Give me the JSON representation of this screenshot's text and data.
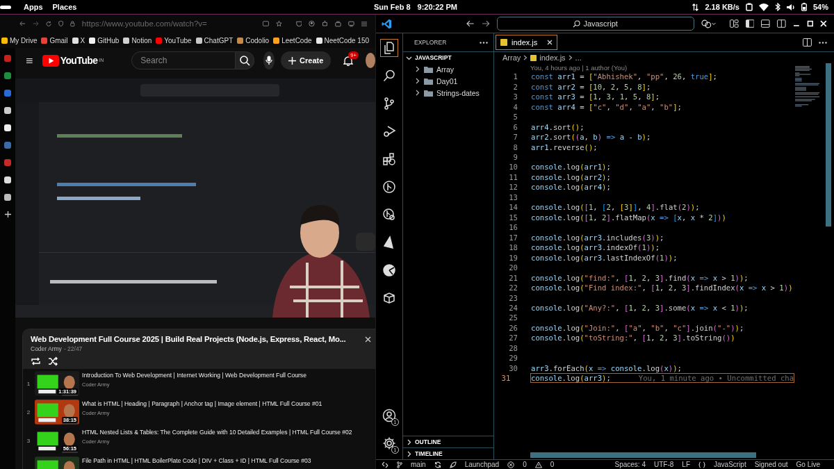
{
  "system_bar": {
    "menus": [
      "Apps",
      "Places"
    ],
    "date": "Sun Feb 8",
    "time": "9:20:22 PM",
    "network_speed": "2.18 KB/s",
    "battery": "54%"
  },
  "browser": {
    "url": "https://www.youtube.com/watch?v=",
    "bookmarks": [
      {
        "label": "My Drive",
        "color": "#fbbc04"
      },
      {
        "label": "Gmail",
        "color": "#ea4335"
      },
      {
        "label": "X",
        "color": "#e0e0e0"
      },
      {
        "label": "GitHub",
        "color": "#f0f0f0"
      },
      {
        "label": "Notion",
        "color": "#d0d0d0"
      },
      {
        "label": "YouTube",
        "color": "#ff0000"
      },
      {
        "label": "ChatGPT",
        "color": "#c8c8c8"
      },
      {
        "label": "Codolio",
        "color": "#c58a4a"
      },
      {
        "label": "LeetCode",
        "color": "#ffa116"
      },
      {
        "label": "NeetCode 150",
        "color": "#e8e8e8"
      }
    ]
  },
  "youtube": {
    "logo": "YouTube",
    "country": "IN",
    "search": {
      "placeholder": "Search"
    },
    "create": "Create",
    "notifications": "9+",
    "playlist": {
      "title": "Web Development Full Course 2025 | Build Real Projects (Node.js, Express, React, Mo...",
      "channel": "Coder Army",
      "position": "- 22/47",
      "items": [
        {
          "index": "1",
          "duration": "1:31:39",
          "title": "Introduction To Web Development | Internet Working | Web Development Full Course",
          "channel": "Coder Army"
        },
        {
          "index": "2",
          "duration": "38:15",
          "title": "What is HTML | Heading | Paragraph | Anchor tag | Image element | HTML Full Course #01",
          "channel": "Coder Army"
        },
        {
          "index": "3",
          "duration": "56:15",
          "title": "HTML Nested Lists & Tables: The Complete Guide with 10 Detailed Examples | HTML Full Course #02",
          "channel": "Coder Army"
        },
        {
          "title": "File Path in HTML | HTML BoilerPlate Code | DIV + Class + ID | HTML Full Course #03"
        }
      ]
    }
  },
  "vscode": {
    "command_center": "Javascript",
    "activity_bar": [
      {
        "kind": "files",
        "selected": true
      },
      {
        "kind": "search",
        "selected": false
      },
      {
        "kind": "branch",
        "selected": false
      },
      {
        "kind": "run",
        "selected": false
      },
      {
        "kind": "extensions",
        "selected": false
      },
      {
        "kind": "graph",
        "selected": false
      },
      {
        "kind": "inspect",
        "selected": false
      },
      {
        "kind": "triangle",
        "selected": false
      },
      {
        "kind": "pie",
        "selected": false
      },
      {
        "kind": "cube",
        "selected": false
      }
    ],
    "activity_bottom": [
      {
        "kind": "account",
        "badge": "1"
      },
      {
        "kind": "settings",
        "badge": "1"
      }
    ],
    "explorer": {
      "title": "EXPLORER",
      "sections": [
        {
          "title": "JAVASCRIPT",
          "expanded": true,
          "children": [
            {
              "label": "Array",
              "expanded": false
            },
            {
              "label": "Day01",
              "expanded": false
            },
            {
              "label": "Strings-dates",
              "expanded": false
            }
          ]
        },
        {
          "title": "OUTLINE",
          "expanded": false
        },
        {
          "title": "TIMELINE",
          "expanded": false
        }
      ]
    },
    "tabs": [
      {
        "label": "index.js",
        "selected": true
      }
    ],
    "breadcrumb": [
      "Array",
      "index.js",
      "..."
    ],
    "blame": "You, 4 hours ago | 1 author (You)",
    "lines": [
      {
        "number": "1",
        "active": false,
        "tokens": [
          {
            "kind": "kw",
            "text": "const "
          },
          {
            "kind": "id",
            "text": "arr1"
          },
          {
            "kind": "op",
            "text": " = "
          },
          {
            "kind": "br1",
            "text": "["
          },
          {
            "kind": "str",
            "text": "\"Abhishek\""
          },
          {
            "kind": "op",
            "text": ", "
          },
          {
            "kind": "str",
            "text": "\"pp\""
          },
          {
            "kind": "op",
            "text": ", "
          },
          {
            "kind": "num",
            "text": "26"
          },
          {
            "kind": "op",
            "text": ", "
          },
          {
            "kind": "kw",
            "text": "true"
          },
          {
            "kind": "br1",
            "text": "]"
          },
          {
            "kind": "op",
            "text": ";"
          }
        ]
      },
      {
        "number": "2",
        "active": false,
        "tokens": [
          {
            "kind": "kw",
            "text": "const "
          },
          {
            "kind": "id",
            "text": "arr2"
          },
          {
            "kind": "op",
            "text": " = "
          },
          {
            "kind": "br1",
            "text": "["
          },
          {
            "kind": "num",
            "text": "10"
          },
          {
            "kind": "op",
            "text": ", "
          },
          {
            "kind": "num",
            "text": "2"
          },
          {
            "kind": "op",
            "text": ", "
          },
          {
            "kind": "num",
            "text": "5"
          },
          {
            "kind": "op",
            "text": ", "
          },
          {
            "kind": "num",
            "text": "8"
          },
          {
            "kind": "br1",
            "text": "]"
          },
          {
            "kind": "op",
            "text": ";"
          }
        ]
      },
      {
        "number": "3",
        "active": false,
        "tokens": [
          {
            "kind": "kw",
            "text": "const "
          },
          {
            "kind": "id",
            "text": "arr3"
          },
          {
            "kind": "op",
            "text": " = "
          },
          {
            "kind": "br1",
            "text": "["
          },
          {
            "kind": "num",
            "text": "1"
          },
          {
            "kind": "op",
            "text": ", "
          },
          {
            "kind": "num",
            "text": "3"
          },
          {
            "kind": "op",
            "text": ", "
          },
          {
            "kind": "num",
            "text": "1"
          },
          {
            "kind": "op",
            "text": ", "
          },
          {
            "kind": "num",
            "text": "5"
          },
          {
            "kind": "op",
            "text": ", "
          },
          {
            "kind": "num",
            "text": "8"
          },
          {
            "kind": "br1",
            "text": "]"
          },
          {
            "kind": "op",
            "text": ";"
          }
        ]
      },
      {
        "number": "4",
        "active": false,
        "tokens": [
          {
            "kind": "kw",
            "text": "const "
          },
          {
            "kind": "id",
            "text": "arr4"
          },
          {
            "kind": "op",
            "text": " = "
          },
          {
            "kind": "br1",
            "text": "["
          },
          {
            "kind": "str",
            "text": "\"c\""
          },
          {
            "kind": "op",
            "text": ", "
          },
          {
            "kind": "str",
            "text": "\"d\""
          },
          {
            "kind": "op",
            "text": ", "
          },
          {
            "kind": "str",
            "text": "\"a\""
          },
          {
            "kind": "op",
            "text": ", "
          },
          {
            "kind": "str",
            "text": "\"b\""
          },
          {
            "kind": "br1",
            "text": "]"
          },
          {
            "kind": "op",
            "text": ";"
          }
        ]
      },
      {
        "number": "5",
        "active": false
      },
      {
        "number": "6",
        "active": false,
        "tokens": [
          {
            "kind": "id",
            "text": "arr4"
          },
          {
            "kind": "op",
            "text": ".sort"
          },
          {
            "kind": "br1",
            "text": "()"
          },
          {
            "kind": "op",
            "text": ";"
          }
        ]
      },
      {
        "number": "7",
        "active": false,
        "tokens": [
          {
            "kind": "id",
            "text": "arr2"
          },
          {
            "kind": "op",
            "text": ".sort"
          },
          {
            "kind": "br1",
            "text": "("
          },
          {
            "kind": "br2",
            "text": "("
          },
          {
            "kind": "id",
            "text": "a"
          },
          {
            "kind": "op",
            "text": ", "
          },
          {
            "kind": "id",
            "text": "b"
          },
          {
            "kind": "br2",
            "text": ")"
          },
          {
            "kind": "kw",
            "text": " => "
          },
          {
            "kind": "id",
            "text": "a"
          },
          {
            "kind": "op",
            "text": " - "
          },
          {
            "kind": "id",
            "text": "b"
          },
          {
            "kind": "br1",
            "text": ")"
          },
          {
            "kind": "op",
            "text": ";"
          }
        ]
      },
      {
        "number": "8",
        "active": false,
        "tokens": [
          {
            "kind": "id",
            "text": "arr1"
          },
          {
            "kind": "op",
            "text": ".reverse"
          },
          {
            "kind": "br1",
            "text": "()"
          },
          {
            "kind": "op",
            "text": ";"
          }
        ]
      },
      {
        "number": "9",
        "active": false
      },
      {
        "number": "10",
        "active": false,
        "tokens": [
          {
            "kind": "id",
            "text": "console"
          },
          {
            "kind": "op",
            "text": ".log"
          },
          {
            "kind": "br1",
            "text": "("
          },
          {
            "kind": "id",
            "text": "arr1"
          },
          {
            "kind": "br1",
            "text": ")"
          },
          {
            "kind": "op",
            "text": ";"
          }
        ]
      },
      {
        "number": "11",
        "active": false,
        "tokens": [
          {
            "kind": "id",
            "text": "console"
          },
          {
            "kind": "op",
            "text": ".log"
          },
          {
            "kind": "br1",
            "text": "("
          },
          {
            "kind": "id",
            "text": "arr2"
          },
          {
            "kind": "br1",
            "text": ")"
          },
          {
            "kind": "op",
            "text": ";"
          }
        ]
      },
      {
        "number": "12",
        "active": false,
        "tokens": [
          {
            "kind": "id",
            "text": "console"
          },
          {
            "kind": "op",
            "text": ".log"
          },
          {
            "kind": "br1",
            "text": "("
          },
          {
            "kind": "id",
            "text": "arr4"
          },
          {
            "kind": "br1",
            "text": ")"
          },
          {
            "kind": "op",
            "text": ";"
          }
        ]
      },
      {
        "number": "13",
        "active": false
      },
      {
        "number": "14",
        "active": false,
        "tokens": [
          {
            "kind": "id",
            "text": "console"
          },
          {
            "kind": "op",
            "text": ".log"
          },
          {
            "kind": "br1",
            "text": "("
          },
          {
            "kind": "br2",
            "text": "["
          },
          {
            "kind": "num",
            "text": "1"
          },
          {
            "kind": "op",
            "text": ", "
          },
          {
            "kind": "br3",
            "text": "["
          },
          {
            "kind": "num",
            "text": "2"
          },
          {
            "kind": "op",
            "text": ", "
          },
          {
            "kind": "br1",
            "text": "["
          },
          {
            "kind": "num",
            "text": "3"
          },
          {
            "kind": "br1",
            "text": "]"
          },
          {
            "kind": "br3",
            "text": "]"
          },
          {
            "kind": "op",
            "text": ", "
          },
          {
            "kind": "num",
            "text": "4"
          },
          {
            "kind": "br2",
            "text": "]"
          },
          {
            "kind": "op",
            "text": ".flat"
          },
          {
            "kind": "br2",
            "text": "("
          },
          {
            "kind": "num",
            "text": "2"
          },
          {
            "kind": "br2",
            "text": ")"
          },
          {
            "kind": "br1",
            "text": ")"
          },
          {
            "kind": "op",
            "text": ";"
          }
        ]
      },
      {
        "number": "15",
        "active": false,
        "tokens": [
          {
            "kind": "id",
            "text": "console"
          },
          {
            "kind": "op",
            "text": ".log"
          },
          {
            "kind": "br1",
            "text": "("
          },
          {
            "kind": "br2",
            "text": "["
          },
          {
            "kind": "num",
            "text": "1"
          },
          {
            "kind": "op",
            "text": ", "
          },
          {
            "kind": "num",
            "text": "2"
          },
          {
            "kind": "br2",
            "text": "]"
          },
          {
            "kind": "op",
            "text": ".flatMap"
          },
          {
            "kind": "br2",
            "text": "("
          },
          {
            "kind": "id",
            "text": "x"
          },
          {
            "kind": "kw",
            "text": " => "
          },
          {
            "kind": "br3",
            "text": "["
          },
          {
            "kind": "id",
            "text": "x"
          },
          {
            "kind": "op",
            "text": ", "
          },
          {
            "kind": "id",
            "text": "x"
          },
          {
            "kind": "op",
            "text": " * "
          },
          {
            "kind": "num",
            "text": "2"
          },
          {
            "kind": "br3",
            "text": "]"
          },
          {
            "kind": "br2",
            "text": ")"
          },
          {
            "kind": "br1",
            "text": ")"
          }
        ]
      },
      {
        "number": "16",
        "active": false
      },
      {
        "number": "17",
        "active": false,
        "tokens": [
          {
            "kind": "id",
            "text": "console"
          },
          {
            "kind": "op",
            "text": ".log"
          },
          {
            "kind": "br1",
            "text": "("
          },
          {
            "kind": "id",
            "text": "arr3"
          },
          {
            "kind": "op",
            "text": ".includes"
          },
          {
            "kind": "br2",
            "text": "("
          },
          {
            "kind": "num",
            "text": "3"
          },
          {
            "kind": "br2",
            "text": ")"
          },
          {
            "kind": "br1",
            "text": ")"
          },
          {
            "kind": "op",
            "text": ";"
          }
        ]
      },
      {
        "number": "18",
        "active": false,
        "tokens": [
          {
            "kind": "id",
            "text": "console"
          },
          {
            "kind": "op",
            "text": ".log"
          },
          {
            "kind": "br1",
            "text": "("
          },
          {
            "kind": "id",
            "text": "arr3"
          },
          {
            "kind": "op",
            "text": ".indexOf"
          },
          {
            "kind": "br2",
            "text": "("
          },
          {
            "kind": "num",
            "text": "1"
          },
          {
            "kind": "br2",
            "text": ")"
          },
          {
            "kind": "br1",
            "text": ")"
          },
          {
            "kind": "op",
            "text": ";"
          }
        ]
      },
      {
        "number": "19",
        "active": false,
        "tokens": [
          {
            "kind": "id",
            "text": "console"
          },
          {
            "kind": "op",
            "text": ".log"
          },
          {
            "kind": "br1",
            "text": "("
          },
          {
            "kind": "id",
            "text": "arr3"
          },
          {
            "kind": "op",
            "text": ".lastIndexOf"
          },
          {
            "kind": "br2",
            "text": "("
          },
          {
            "kind": "num",
            "text": "1"
          },
          {
            "kind": "br2",
            "text": ")"
          },
          {
            "kind": "br1",
            "text": ")"
          },
          {
            "kind": "op",
            "text": ";"
          }
        ]
      },
      {
        "number": "20",
        "active": false
      },
      {
        "number": "21",
        "active": false,
        "tokens": [
          {
            "kind": "id",
            "text": "console"
          },
          {
            "kind": "op",
            "text": ".log"
          },
          {
            "kind": "br1",
            "text": "("
          },
          {
            "kind": "str",
            "text": "\"find:\""
          },
          {
            "kind": "op",
            "text": ", "
          },
          {
            "kind": "br2",
            "text": "["
          },
          {
            "kind": "num",
            "text": "1"
          },
          {
            "kind": "op",
            "text": ", "
          },
          {
            "kind": "num",
            "text": "2"
          },
          {
            "kind": "op",
            "text": ", "
          },
          {
            "kind": "num",
            "text": "3"
          },
          {
            "kind": "br2",
            "text": "]"
          },
          {
            "kind": "op",
            "text": ".find"
          },
          {
            "kind": "br2",
            "text": "("
          },
          {
            "kind": "id",
            "text": "x"
          },
          {
            "kind": "kw",
            "text": " => "
          },
          {
            "kind": "id",
            "text": "x"
          },
          {
            "kind": "op",
            "text": " > "
          },
          {
            "kind": "num",
            "text": "1"
          },
          {
            "kind": "br2",
            "text": ")"
          },
          {
            "kind": "br1",
            "text": ")"
          },
          {
            "kind": "op",
            "text": ";"
          }
        ]
      },
      {
        "number": "22",
        "active": false,
        "tokens": [
          {
            "kind": "id",
            "text": "console"
          },
          {
            "kind": "op",
            "text": ".log"
          },
          {
            "kind": "br1",
            "text": "("
          },
          {
            "kind": "str",
            "text": "\"Find index:\""
          },
          {
            "kind": "op",
            "text": ", "
          },
          {
            "kind": "br2",
            "text": "["
          },
          {
            "kind": "num",
            "text": "1"
          },
          {
            "kind": "op",
            "text": ", "
          },
          {
            "kind": "num",
            "text": "2"
          },
          {
            "kind": "op",
            "text": ", "
          },
          {
            "kind": "num",
            "text": "3"
          },
          {
            "kind": "br2",
            "text": "]"
          },
          {
            "kind": "op",
            "text": ".findIndex"
          },
          {
            "kind": "br2",
            "text": "("
          },
          {
            "kind": "id",
            "text": "x"
          },
          {
            "kind": "kw",
            "text": " => "
          },
          {
            "kind": "id",
            "text": "x"
          },
          {
            "kind": "op",
            "text": " > "
          },
          {
            "kind": "num",
            "text": "1"
          },
          {
            "kind": "br2",
            "text": ")"
          },
          {
            "kind": "br1",
            "text": ")"
          }
        ]
      },
      {
        "number": "23",
        "active": false
      },
      {
        "number": "24",
        "active": false,
        "tokens": [
          {
            "kind": "id",
            "text": "console"
          },
          {
            "kind": "op",
            "text": ".log"
          },
          {
            "kind": "br1",
            "text": "("
          },
          {
            "kind": "str",
            "text": "\"Any?:\""
          },
          {
            "kind": "op",
            "text": ", "
          },
          {
            "kind": "br2",
            "text": "["
          },
          {
            "kind": "num",
            "text": "1"
          },
          {
            "kind": "op",
            "text": ", "
          },
          {
            "kind": "num",
            "text": "2"
          },
          {
            "kind": "op",
            "text": ", "
          },
          {
            "kind": "num",
            "text": "3"
          },
          {
            "kind": "br2",
            "text": "]"
          },
          {
            "kind": "op",
            "text": ".some"
          },
          {
            "kind": "br2",
            "text": "("
          },
          {
            "kind": "id",
            "text": "x"
          },
          {
            "kind": "kw",
            "text": " => "
          },
          {
            "kind": "id",
            "text": "x"
          },
          {
            "kind": "op",
            "text": " < "
          },
          {
            "kind": "num",
            "text": "1"
          },
          {
            "kind": "br2",
            "text": ")"
          },
          {
            "kind": "br1",
            "text": ")"
          },
          {
            "kind": "op",
            "text": ";"
          }
        ]
      },
      {
        "number": "25",
        "active": false
      },
      {
        "number": "26",
        "active": false,
        "tokens": [
          {
            "kind": "id",
            "text": "console"
          },
          {
            "kind": "op",
            "text": ".log"
          },
          {
            "kind": "br1",
            "text": "("
          },
          {
            "kind": "str",
            "text": "\"Join:\""
          },
          {
            "kind": "op",
            "text": ", "
          },
          {
            "kind": "br2",
            "text": "["
          },
          {
            "kind": "str",
            "text": "\"a\""
          },
          {
            "kind": "op",
            "text": ", "
          },
          {
            "kind": "str",
            "text": "\"b\""
          },
          {
            "kind": "op",
            "text": ", "
          },
          {
            "kind": "str",
            "text": "\"c\""
          },
          {
            "kind": "br2",
            "text": "]"
          },
          {
            "kind": "op",
            "text": ".join"
          },
          {
            "kind": "br2",
            "text": "("
          },
          {
            "kind": "str",
            "text": "\"-\""
          },
          {
            "kind": "br2",
            "text": ")"
          },
          {
            "kind": "br1",
            "text": ")"
          },
          {
            "kind": "op",
            "text": ";"
          }
        ]
      },
      {
        "number": "27",
        "active": false,
        "tokens": [
          {
            "kind": "id",
            "text": "console"
          },
          {
            "kind": "op",
            "text": ".log"
          },
          {
            "kind": "br1",
            "text": "("
          },
          {
            "kind": "str",
            "text": "\"toString:\""
          },
          {
            "kind": "op",
            "text": ", "
          },
          {
            "kind": "br2",
            "text": "["
          },
          {
            "kind": "num",
            "text": "1"
          },
          {
            "kind": "op",
            "text": ", "
          },
          {
            "kind": "num",
            "text": "2"
          },
          {
            "kind": "op",
            "text": ", "
          },
          {
            "kind": "num",
            "text": "3"
          },
          {
            "kind": "br2",
            "text": "]"
          },
          {
            "kind": "op",
            "text": ".toString"
          },
          {
            "kind": "br2",
            "text": "()"
          },
          {
            "kind": "br1",
            "text": ")"
          }
        ]
      },
      {
        "number": "28",
        "active": false
      },
      {
        "number": "29",
        "active": false
      },
      {
        "number": "30",
        "active": false,
        "tokens": [
          {
            "kind": "id",
            "text": "arr3"
          },
          {
            "kind": "op",
            "text": ".forEach"
          },
          {
            "kind": "br1",
            "text": "("
          },
          {
            "kind": "id",
            "text": "x"
          },
          {
            "kind": "kw",
            "text": " => "
          },
          {
            "kind": "id",
            "text": "console"
          },
          {
            "kind": "op",
            "text": ".log"
          },
          {
            "kind": "br2",
            "text": "("
          },
          {
            "kind": "id",
            "text": "x"
          },
          {
            "kind": "br2",
            "text": ")"
          },
          {
            "kind": "br1",
            "text": ")"
          },
          {
            "kind": "op",
            "text": ";"
          }
        ]
      },
      {
        "number": "31",
        "active": true,
        "blame": "You, 1 minute ago • Uncommitted cha",
        "tokens": [
          {
            "kind": "id",
            "text": "console"
          },
          {
            "kind": "op",
            "text": ".log"
          },
          {
            "kind": "br1",
            "text": "("
          },
          {
            "kind": "id",
            "text": "arr3"
          },
          {
            "kind": "br1",
            "text": ")"
          },
          {
            "kind": "op",
            "text": ";"
          }
        ]
      }
    ],
    "status_bar": {
      "branch": "main",
      "launchpad": "Launchpad",
      "errors": "0",
      "warnings": "0",
      "spaces": "Spaces: 4",
      "encoding": "UTF-8",
      "eol": "LF",
      "language": "JavaScript",
      "account": "Signed out",
      "live": "Go Live"
    }
  }
}
